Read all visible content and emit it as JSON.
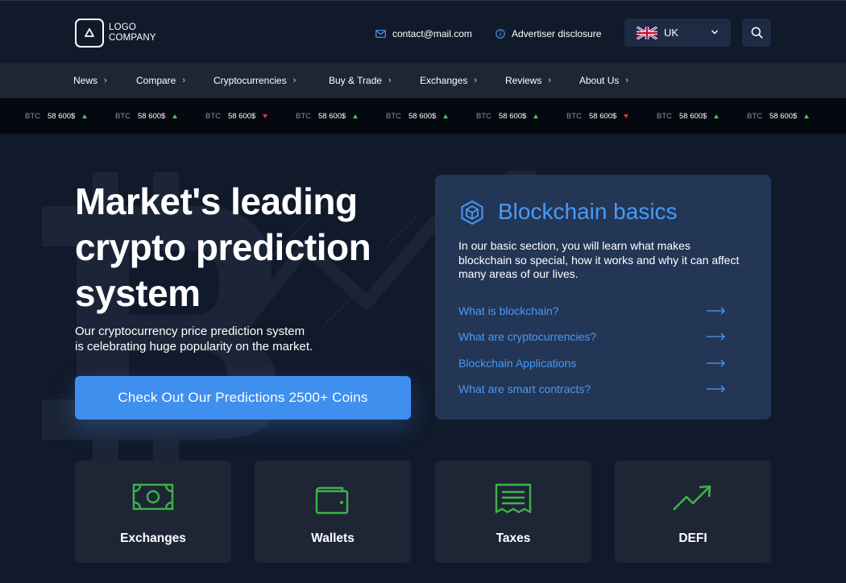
{
  "header": {
    "logo_line1": "LOGO",
    "logo_line2": "COMPANY",
    "contact_email": "contact@mail.com",
    "advertiser_disclosure": "Advertiser disclosure",
    "language": "UK",
    "icons": [
      "mail-icon",
      "info-icon",
      "uk-flag-icon",
      "chevron-down-icon",
      "search-icon"
    ]
  },
  "nav": {
    "items": [
      {
        "label": "News"
      },
      {
        "label": "Compare"
      },
      {
        "label": "Cryptocurrencies"
      },
      {
        "label": "Buy & Trade"
      },
      {
        "label": "Exchanges"
      },
      {
        "label": "Reviews"
      },
      {
        "label": "About Us"
      }
    ]
  },
  "ticker": {
    "items": [
      {
        "symbol": "BTC",
        "price": "58 600$",
        "direction": "up"
      },
      {
        "symbol": "BTC",
        "price": "58 600$",
        "direction": "up"
      },
      {
        "symbol": "BTC",
        "price": "58 600$",
        "direction": "down"
      },
      {
        "symbol": "BTC",
        "price": "58 600$",
        "direction": "up"
      },
      {
        "symbol": "BTC",
        "price": "58 600$",
        "direction": "up"
      },
      {
        "symbol": "BTC",
        "price": "58 600$",
        "direction": "up"
      },
      {
        "symbol": "BTC",
        "price": "58 600$",
        "direction": "down"
      },
      {
        "symbol": "BTC",
        "price": "58 600$",
        "direction": "up"
      },
      {
        "symbol": "BTC",
        "price": "58 600$",
        "direction": "up"
      }
    ]
  },
  "hero": {
    "title_line1": "Market's leading",
    "title_line2": "crypto prediction",
    "title_line3": "system",
    "subtitle_line1": "Our cryptocurrency price prediction system",
    "subtitle_line2": "is celebrating huge popularity on the market.",
    "cta_label": "Check Out Our Predictions 2500+ Coins"
  },
  "blockchain": {
    "title": "Blockchain basics",
    "description": "In our basic section, you will learn what makes blockchain so special, how it works and why it can affect many areas of our lives.",
    "links": [
      {
        "label": "What is blockchain?"
      },
      {
        "label": "What are cryptocurrencies?"
      },
      {
        "label": "Blockchain Applications"
      },
      {
        "label": "What are smart contracts?"
      }
    ]
  },
  "categories": [
    {
      "label": "Exchanges",
      "icon": "banknote-icon"
    },
    {
      "label": "Wallets",
      "icon": "wallet-icon"
    },
    {
      "label": "Taxes",
      "icon": "receipt-icon"
    },
    {
      "label": "DEFI",
      "icon": "trending-up-icon"
    }
  ],
  "colors": {
    "background": "#111a2b",
    "nav_bg": "#1e2636",
    "ticker_bg": "#05080f",
    "accent_blue": "#3f8fee",
    "link_blue": "#4a9af5",
    "card_blue": "#233656",
    "icon_green": "#3fb34a",
    "up_green": "#3dd04a",
    "down_red": "#e8343a"
  }
}
